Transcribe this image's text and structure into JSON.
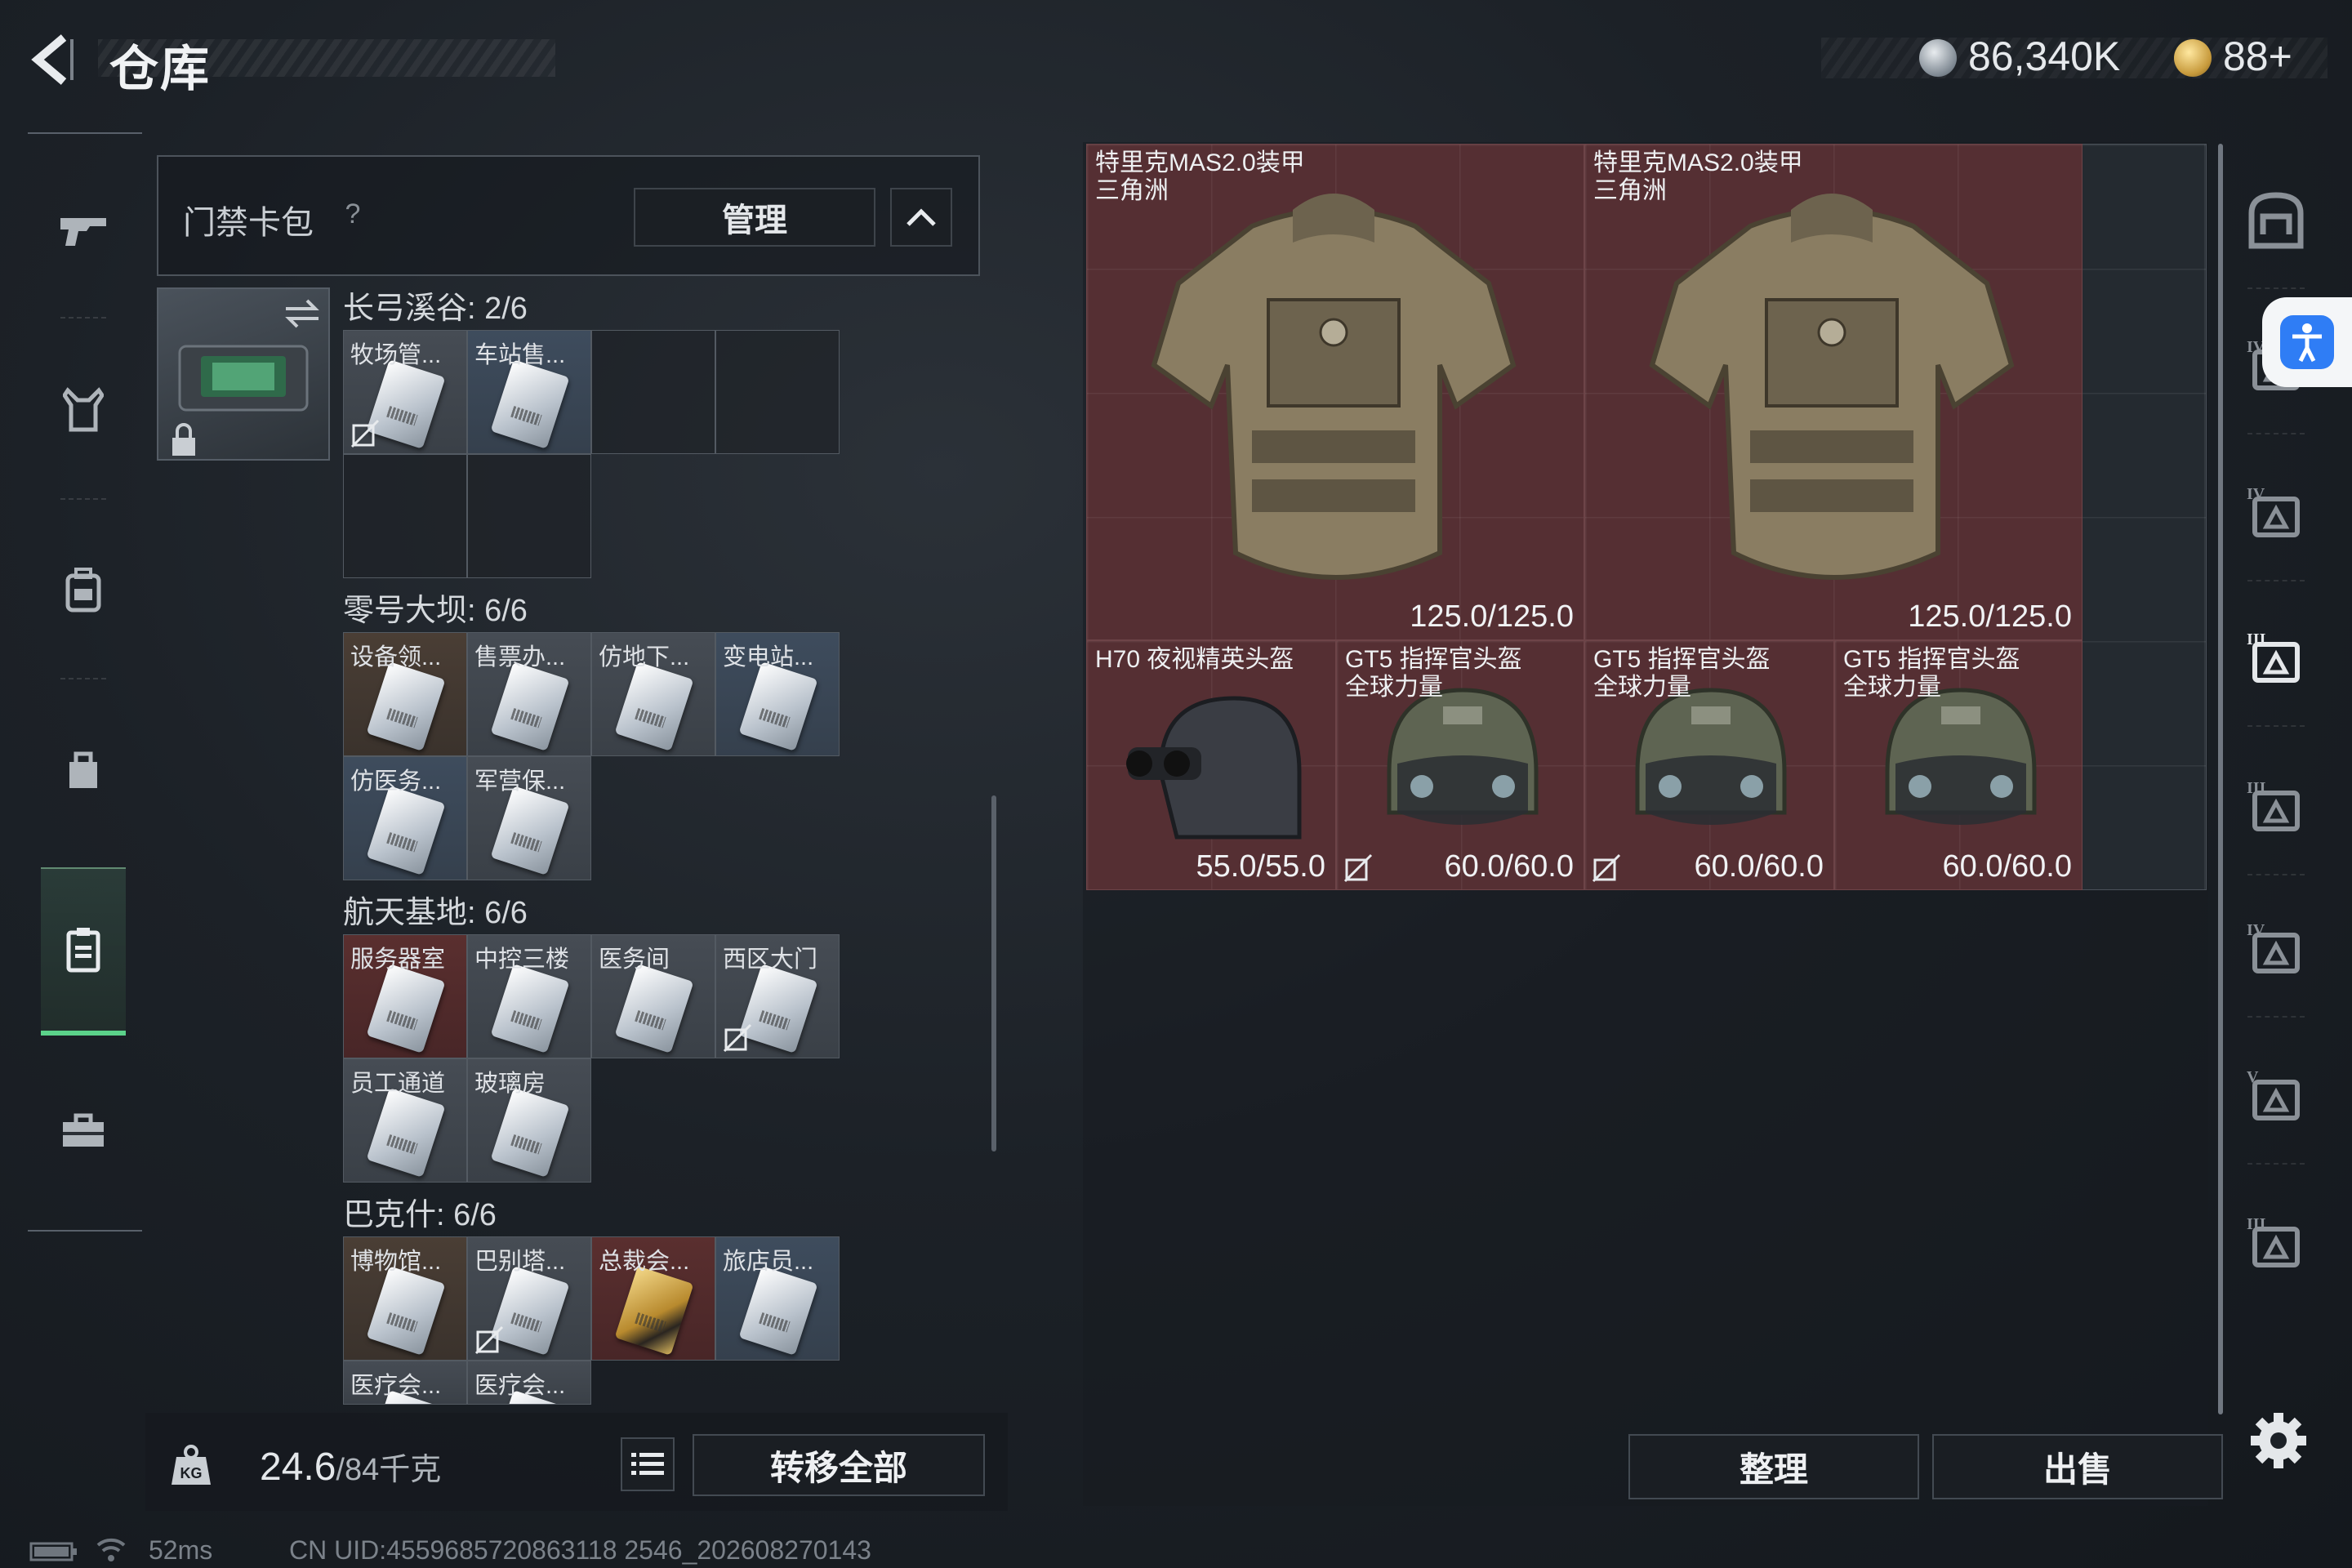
{
  "header": {
    "title": "仓库",
    "currency_silver": "86,340K",
    "currency_gold": "88+"
  },
  "left_nav": {
    "items": [
      "gun",
      "vest",
      "backpack",
      "bag",
      "card-holder",
      "toolbox"
    ],
    "active": "card-holder"
  },
  "card_pack": {
    "title": "门禁卡包",
    "help": "?",
    "manage_label": "管理"
  },
  "sections": [
    {
      "label": "长弓溪谷: 2/6",
      "cards": [
        {
          "name": "牧场管...",
          "bg": "grey",
          "nocopy": true
        },
        {
          "name": "车站售...",
          "bg": "blue",
          "nocopy": false
        }
      ]
    },
    {
      "label": "零号大坝: 6/6",
      "cards": [
        {
          "name": "设备领...",
          "bg": "brown"
        },
        {
          "name": "售票办...",
          "bg": "grey"
        },
        {
          "name": "仿地下...",
          "bg": "grey"
        },
        {
          "name": "变电站...",
          "bg": "blue"
        },
        {
          "name": "仿医务...",
          "bg": "blue"
        },
        {
          "name": "军营保...",
          "bg": "grey"
        }
      ]
    },
    {
      "label": "航天基地: 6/6",
      "cards": [
        {
          "name": "服务器室",
          "bg": "red"
        },
        {
          "name": "中控三楼",
          "bg": "grey"
        },
        {
          "name": "医务间",
          "bg": "grey"
        },
        {
          "name": "西区大门",
          "bg": "grey",
          "nocopy": true
        },
        {
          "name": "员工通道",
          "bg": "grey"
        },
        {
          "name": "玻璃房",
          "bg": "grey"
        }
      ]
    },
    {
      "label": "巴克什: 6/6",
      "cards": [
        {
          "name": "博物馆...",
          "bg": "brown"
        },
        {
          "name": "巴别塔...",
          "bg": "grey",
          "nocopy": true
        },
        {
          "name": "总裁会...",
          "bg": "red",
          "gold": true
        },
        {
          "name": "旅店员...",
          "bg": "blue"
        },
        {
          "name": "医疗会...",
          "bg": "grey"
        },
        {
          "name": "医疗会...",
          "bg": "grey"
        }
      ]
    }
  ],
  "bottom_left": {
    "weight_value": "24.6",
    "weight_capacity": "/84千克",
    "transfer_label": "转移全部"
  },
  "stash_items": [
    {
      "name": "特里克MAS2.0装甲\n三角洲",
      "durability": "125.0/125.0",
      "kind": "armor"
    },
    {
      "name": "特里克MAS2.0装甲\n三角洲",
      "durability": "125.0/125.0",
      "kind": "armor"
    },
    {
      "name": "H70 夜视精英头盔",
      "durability": "55.0/55.0",
      "kind": "helmet-nv"
    },
    {
      "name": "GT5 指挥官头盔\n全球力量",
      "durability": "60.0/60.0",
      "kind": "helmet",
      "nocopy": true
    },
    {
      "name": "GT5 指挥官头盔\n全球力量",
      "durability": "60.0/60.0",
      "kind": "helmet",
      "nocopy": true
    },
    {
      "name": "GT5 指挥官头盔\n全球力量",
      "durability": "60.0/60.0",
      "kind": "helmet"
    }
  ],
  "right_actions": {
    "sort_label": "整理",
    "sell_label": "出售"
  },
  "right_nav_tiers": [
    "",
    "IV",
    "IV",
    "III",
    "III",
    "IV",
    "V",
    "III"
  ],
  "status": {
    "ping": "52ms",
    "uid": "CN UID:4559685720863118 2546_202608270143"
  }
}
